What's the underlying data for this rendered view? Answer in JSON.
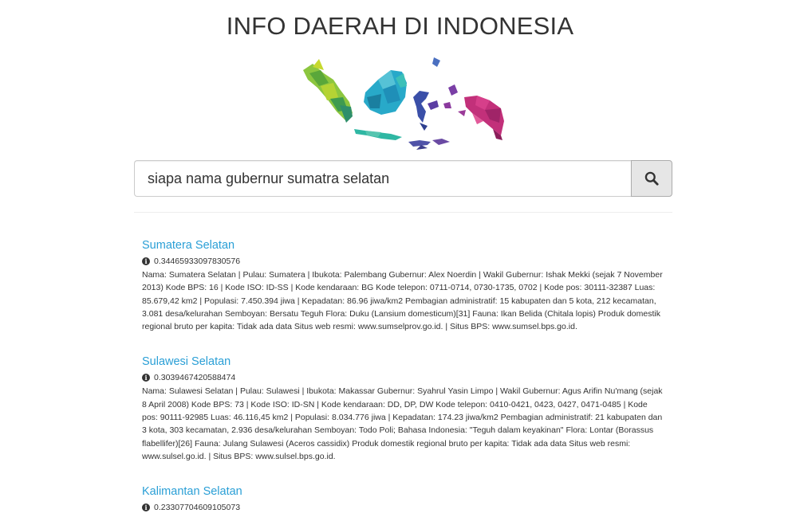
{
  "page": {
    "title": "INFO DAERAH DI INDONESIA"
  },
  "search": {
    "value": "siapa nama gubernur sumatra selatan",
    "button_icon": "search-icon"
  },
  "colors": {
    "link": "#2a9fd6",
    "button_bg": "#e6e6e6"
  },
  "results": [
    {
      "title": "Sumatera Selatan",
      "score": "0.34465933097830576",
      "description": "Nama: Sumatera Selatan | Pulau: Sumatera | Ibukota: Palembang Gubernur: Alex Noerdin | Wakil Gubernur: Ishak Mekki (sejak 7 November 2013) Kode BPS: 16 | Kode ISO: ID-SS | Kode kendaraan: BG Kode telepon: 0711-0714, 0730-1735, 0702 | Kode pos: 30111-32387 Luas: 85.679,42 km2 | Populasi: 7.450.394 jiwa | Kepadatan: 86.96 jiwa/km2 Pembagian administratif: 15 kabupaten dan 5 kota, 212 kecamatan, 3.081 desa/kelurahan Semboyan: Bersatu Teguh Flora: Duku (Lansium domesticum)[31] Fauna: Ikan Belida (Chitala lopis) Produk domestik regional bruto per kapita: Tidak ada data Situs web resmi: www.sumselprov.go.id. | Situs BPS: www.sumsel.bps.go.id."
    },
    {
      "title": "Sulawesi Selatan",
      "score": "0.3039467420588474",
      "description": "Nama: Sulawesi Selatan | Pulau: Sulawesi | Ibukota: Makassar Gubernur: Syahrul Yasin Limpo | Wakil Gubernur: Agus Arifin Nu'mang (sejak 8 April 2008) Kode BPS: 73 | Kode ISO: ID-SN | Kode kendaraan: DD, DP, DW Kode telepon: 0410-0421, 0423, 0427, 0471-0485 | Kode pos: 90111-92985 Luas: 46.116,45 km2 | Populasi: 8.034.776 jiwa | Kepadatan: 174.23 jiwa/km2 Pembagian administratif: 21 kabupaten dan 3 kota, 303 kecamatan, 2.936 desa/kelurahan Semboyan: Todo Poli; Bahasa Indonesia: \"Teguh dalam keyakinan\" Flora: Lontar (Borassus flabellifer)[26] Fauna: Julang Sulawesi (Aceros cassidix) Produk domestik regional bruto per kapita: Tidak ada data Situs web resmi: www.sulsel.go.id. | Situs BPS: www.sulsel.bps.go.id."
    },
    {
      "title": "Kalimantan Selatan",
      "score": "0.23307704609105073",
      "description": ""
    }
  ]
}
